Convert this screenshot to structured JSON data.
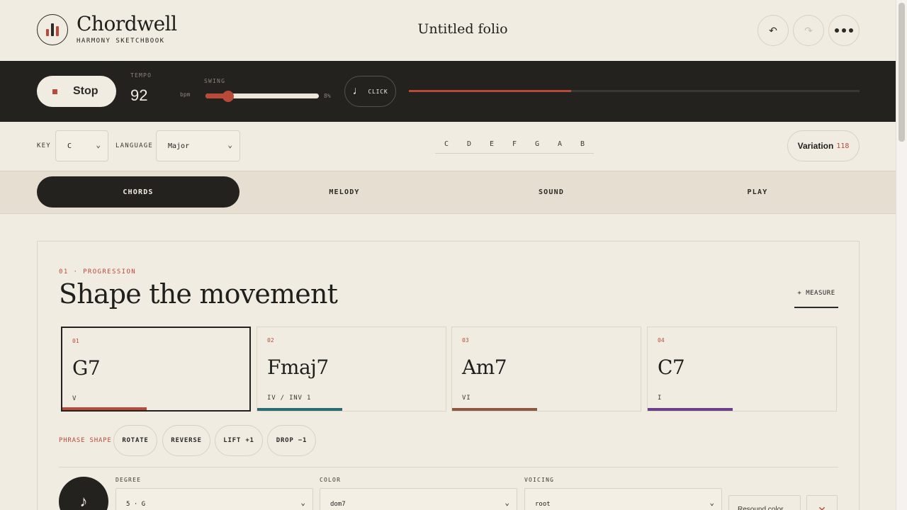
{
  "header": {
    "brand": "Chordwell",
    "tagline": "HARMONY SKETCHBOOK",
    "doc_title": "Untitled folio",
    "undo_icon": "↶",
    "redo_icon": "↷"
  },
  "transport": {
    "stop_label": "Stop",
    "tempo_label": "TEMPO",
    "tempo_value": "92",
    "tempo_unit": "bpm",
    "swing_label": "SWING",
    "swing_value": "8%",
    "swing_fraction": 0.2,
    "click_icon": "♩",
    "click_label": "CLICK",
    "playhead_fraction": 0.36
  },
  "keyrow": {
    "key_label": "KEY",
    "key_value": "C",
    "language_label": "LANGUAGE",
    "language_value": "Major",
    "notes": [
      "C",
      "D",
      "E",
      "F",
      "G",
      "A",
      "B"
    ],
    "variation_label": "Variation",
    "variation_number": "118"
  },
  "tabs": [
    "CHORDS",
    "MELODY",
    "SOUND",
    "PLAY"
  ],
  "progression": {
    "eyebrow": "01 · PROGRESSION",
    "heading": "Shape the movement",
    "add_measure": "+ MEASURE",
    "chords": [
      {
        "num": "01",
        "name": "G7",
        "degree": "V",
        "color": "#b94a3a"
      },
      {
        "num": "02",
        "name": "Fmaj7",
        "degree": "IV / INV 1",
        "color": "#2c6a78"
      },
      {
        "num": "03",
        "name": "Am7",
        "degree": "VI",
        "color": "#8a5a42"
      },
      {
        "num": "04",
        "name": "C7",
        "degree": "I",
        "color": "#6b3f8a"
      }
    ],
    "phrase_label": "PHRASE SHAPE",
    "phrase_buttons": [
      "ROTATE",
      "REVERSE",
      "LIFT +1",
      "DROP −1"
    ]
  },
  "editor": {
    "play_icon": "♪",
    "degree_label": "DEGREE",
    "degree_value": "5 · G",
    "color_label": "COLOR",
    "color_value": "dom7",
    "voicing_label": "VOICING",
    "voicing_value": "root",
    "resound_label": "Resound color",
    "delete_icon": "✕"
  },
  "colors": {
    "accent": "#b94a3a",
    "ink": "#23221f",
    "paper": "#f1ece1"
  }
}
